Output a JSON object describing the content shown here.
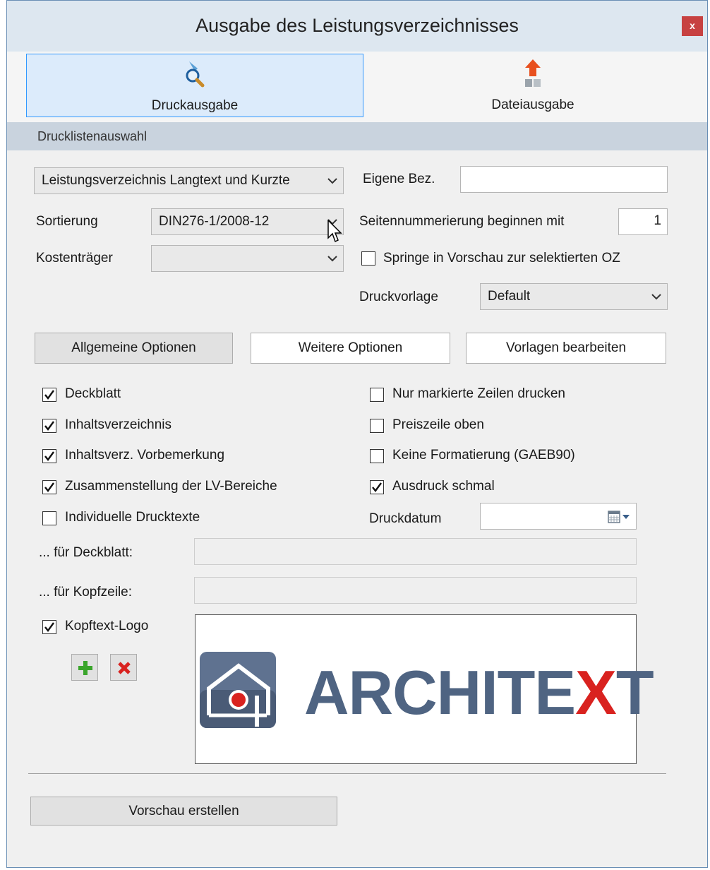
{
  "window": {
    "title": "Ausgabe des Leistungsverzeichnisses",
    "close_label": "x"
  },
  "modes": [
    {
      "label": "Druckausgabe",
      "icon": "magnifier-print-icon",
      "active": true
    },
    {
      "label": "Dateiausgabe",
      "icon": "file-export-icon",
      "active": false
    }
  ],
  "section": {
    "title": "Drucklistenauswahl"
  },
  "form": {
    "list_select_value": "Leistungsverzeichnis Langtext und Kurzte",
    "own_label": "Eigene Bez.",
    "own_value": "",
    "sort_label": "Sortierung",
    "sort_value": "DIN276-1/2008-12",
    "cost_label": "Kostenträger",
    "cost_value": "",
    "page_start_label": "Seitennummerierung beginnen mit",
    "page_start_value": "1",
    "jump_label": "Springe in Vorschau zur selektierten OZ",
    "jump_checked": false,
    "template_label": "Druckvorlage",
    "template_value": "Default"
  },
  "tabs": [
    {
      "label": "Allgemeine Optionen",
      "active": true
    },
    {
      "label": "Weitere Optionen",
      "active": false
    },
    {
      "label": "Vorlagen bearbeiten",
      "active": false
    }
  ],
  "options_left": [
    {
      "label": "Deckblatt",
      "checked": true
    },
    {
      "label": "Inhaltsverzeichnis",
      "checked": true
    },
    {
      "label": "Inhaltsverz. Vorbemerkung",
      "checked": true
    },
    {
      "label": "Zusammenstellung der LV-Bereiche",
      "checked": true
    },
    {
      "label": "Individuelle Drucktexte",
      "checked": false
    }
  ],
  "options_right": [
    {
      "label": "Nur markierte Zeilen drucken",
      "checked": false
    },
    {
      "label": "Preiszeile oben",
      "checked": false
    },
    {
      "label": "Keine Formatierung (GAEB90)",
      "checked": false
    },
    {
      "label": "Ausdruck schmal",
      "checked": true
    }
  ],
  "date": {
    "label": "Druckdatum",
    "value": ""
  },
  "texts": {
    "cover_label": "... für Deckblatt:",
    "cover_value": "",
    "header_label": "... für Kopfzeile:",
    "header_value": ""
  },
  "logo": {
    "label": "Kopftext-Logo",
    "checked": true,
    "text_main": "ARCHITE",
    "text_accent": "X",
    "text_end": "T",
    "text_color": "#4f6482",
    "accent_color": "#d9221f"
  },
  "buttons": {
    "preview_label": "Vorschau erstellen"
  },
  "colors": {
    "accent_blue": "#3399ff",
    "section_bg": "#c9d3de",
    "title_bg": "#dde7f0",
    "close_red": "#c74141"
  }
}
